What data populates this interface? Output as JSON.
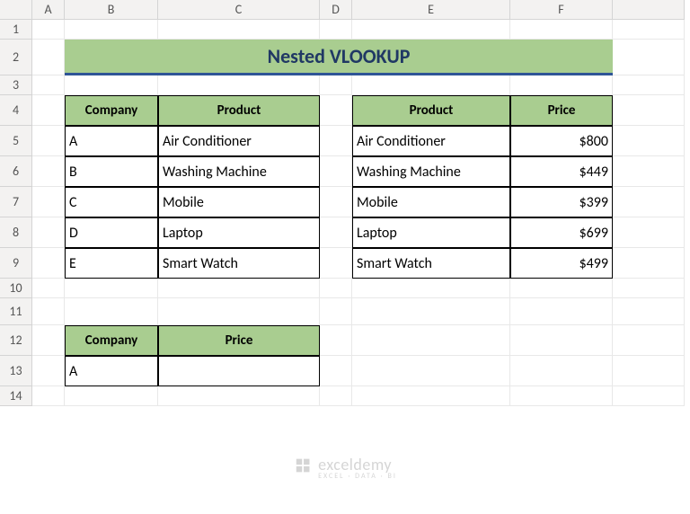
{
  "columns": [
    "A",
    "B",
    "C",
    "D",
    "E",
    "F"
  ],
  "rows": [
    "1",
    "2",
    "3",
    "4",
    "5",
    "6",
    "7",
    "8",
    "9",
    "10",
    "11",
    "12",
    "13",
    "14"
  ],
  "title": "Nested VLOOKUP",
  "table1": {
    "headers": {
      "company": "Company",
      "product": "Product"
    },
    "rows": [
      {
        "company": "A",
        "product": "Air Conditioner"
      },
      {
        "company": "B",
        "product": "Washing Machine"
      },
      {
        "company": "C",
        "product": "Mobile"
      },
      {
        "company": "D",
        "product": "Laptop"
      },
      {
        "company": "E",
        "product": "Smart Watch"
      }
    ]
  },
  "table2": {
    "headers": {
      "product": "Product",
      "price": "Price"
    },
    "rows": [
      {
        "product": "Air Conditioner",
        "price": "$800"
      },
      {
        "product": "Washing Machine",
        "price": "$449"
      },
      {
        "product": "Mobile",
        "price": "$399"
      },
      {
        "product": "Laptop",
        "price": "$699"
      },
      {
        "product": "Smart Watch",
        "price": "$499"
      }
    ]
  },
  "table3": {
    "headers": {
      "company": "Company",
      "price": "Price"
    },
    "rows": [
      {
        "company": "A",
        "price": ""
      }
    ]
  },
  "watermark": {
    "main": "exceldemy",
    "sub": "EXCEL · DATA · BI"
  }
}
